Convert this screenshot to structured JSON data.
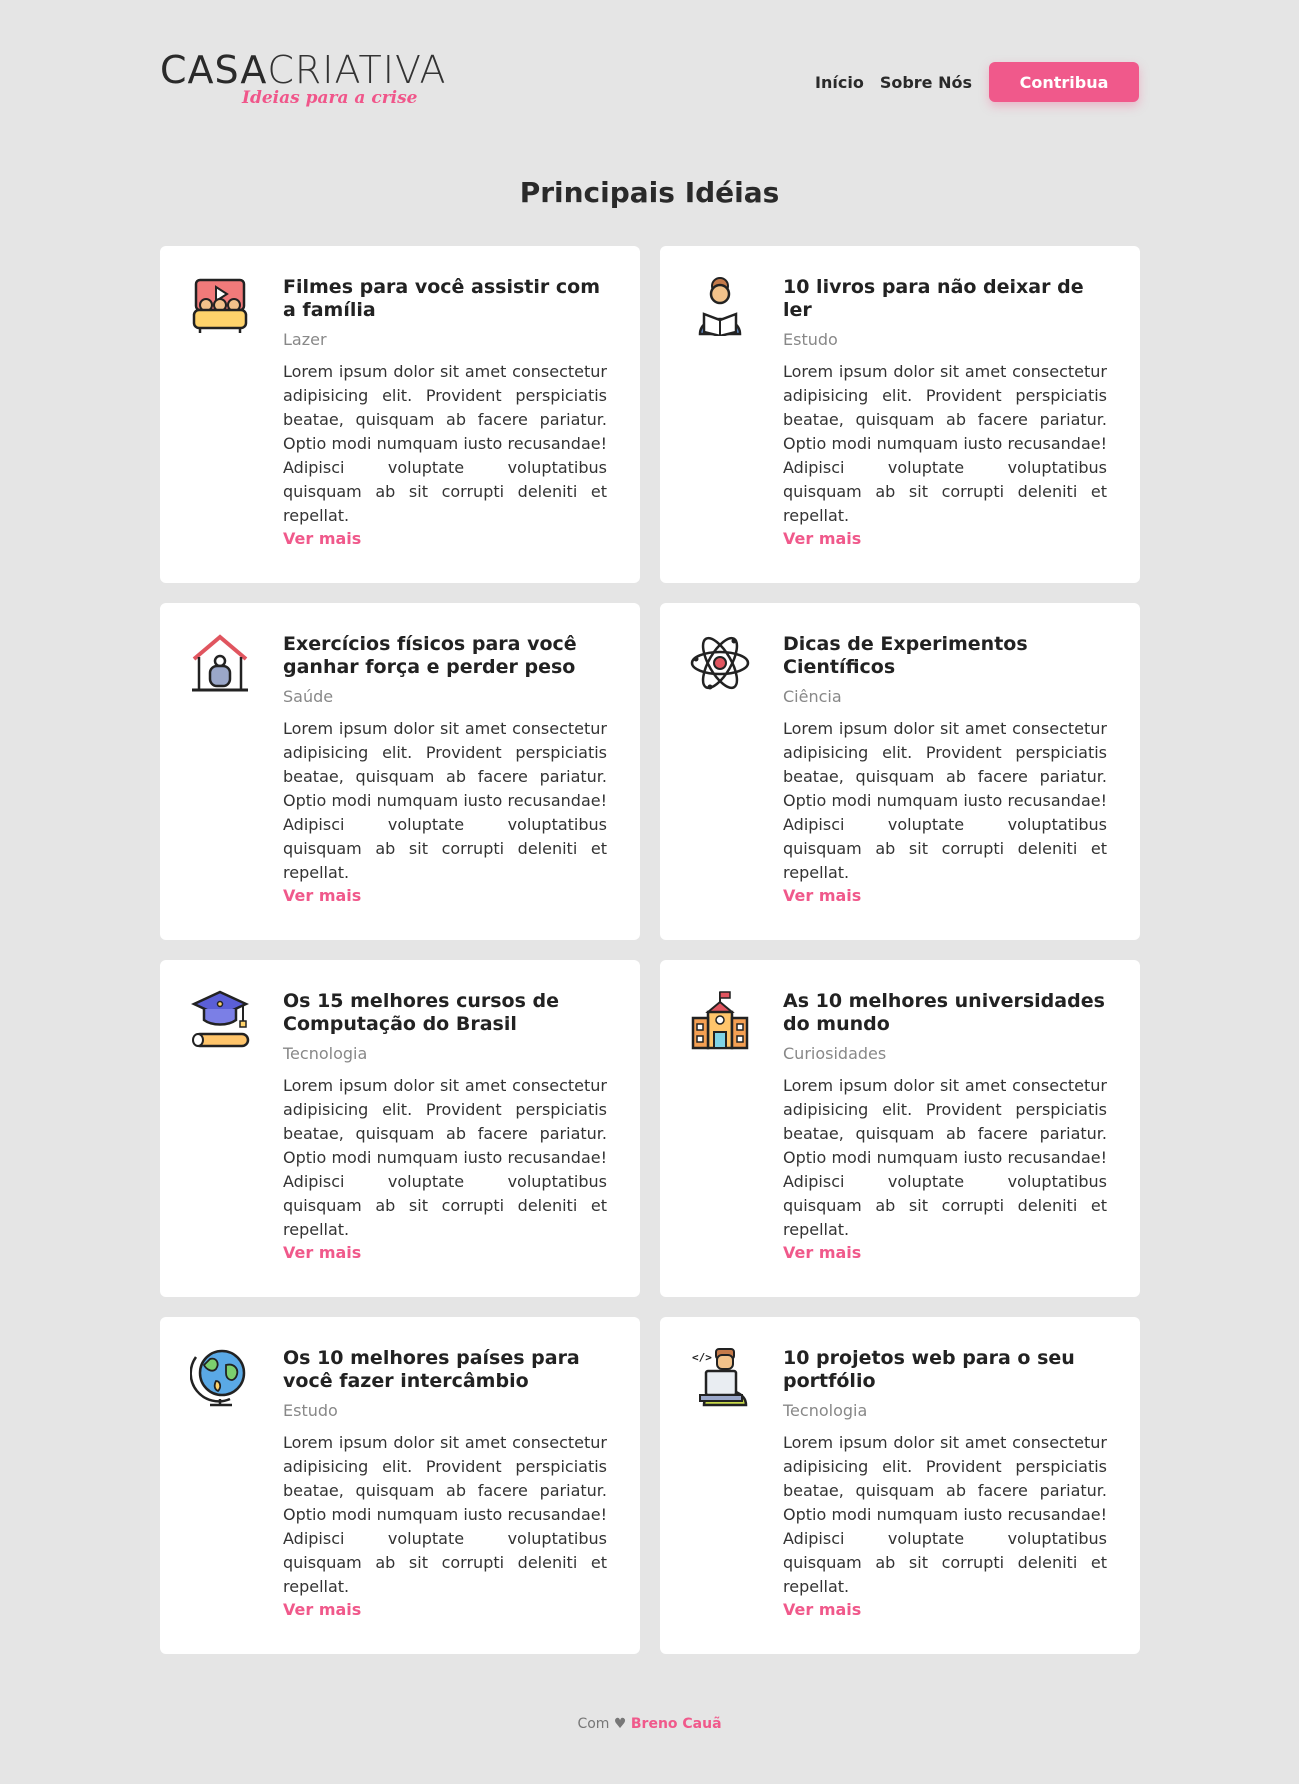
{
  "header": {
    "logo_part1": "CASA",
    "logo_part2": "CRIATIVA",
    "logo_tagline": "Ideias para a crise",
    "nav": {
      "inicio": "Início",
      "sobre": "Sobre Nós",
      "contribua": "Contribua"
    }
  },
  "main": {
    "title": "Principais Idéias",
    "cards": [
      {
        "title": "Filmes para você assistir com a família",
        "category": "Lazer",
        "icon": "movie-couch-icon",
        "text": "Lorem ipsum dolor sit amet consectetur adipisicing elit. Provident perspiciatis beatae, quisquam ab facere pariatur. Optio modi numquam iusto recusandae! Adipisci voluptate voluptatibus quisquam ab sit corrupti deleniti et repellat.",
        "more": "Ver mais"
      },
      {
        "title": "10 livros para não deixar de ler",
        "category": "Estudo",
        "icon": "reader-icon",
        "text": "Lorem ipsum dolor sit amet consectetur adipisicing elit. Provident perspiciatis beatae, quisquam ab facere pariatur. Optio modi numquam iusto recusandae! Adipisci voluptate voluptatibus quisquam ab sit corrupti deleniti et repellat.",
        "more": "Ver mais"
      },
      {
        "title": "Exercícios físicos para você ganhar força e perder peso",
        "category": "Saúde",
        "icon": "home-workout-icon",
        "text": "Lorem ipsum dolor sit amet consectetur adipisicing elit. Provident perspiciatis beatae, quisquam ab facere pariatur. Optio modi numquam iusto recusandae! Adipisci voluptate voluptatibus quisquam ab sit corrupti deleniti et repellat.",
        "more": "Ver mais"
      },
      {
        "title": "Dicas de Experimentos Científicos",
        "category": "Ciência",
        "icon": "atom-icon",
        "text": "Lorem ipsum dolor sit amet consectetur adipisicing elit. Provident perspiciatis beatae, quisquam ab facere pariatur. Optio modi numquam iusto recusandae! Adipisci voluptate voluptatibus quisquam ab sit corrupti deleniti et repellat.",
        "more": "Ver mais"
      },
      {
        "title": "Os 15 melhores cursos de Computação do Brasil",
        "category": "Tecnologia",
        "icon": "graduation-cap-icon",
        "text": "Lorem ipsum dolor sit amet consectetur adipisicing elit. Provident perspiciatis beatae, quisquam ab facere pariatur. Optio modi numquam iusto recusandae! Adipisci voluptate voluptatibus quisquam ab sit corrupti deleniti et repellat.",
        "more": "Ver mais"
      },
      {
        "title": "As 10 melhores universidades do mundo",
        "category": "Curiosidades",
        "icon": "university-icon",
        "text": "Lorem ipsum dolor sit amet consectetur adipisicing elit. Provident perspiciatis beatae, quisquam ab facere pariatur. Optio modi numquam iusto recusandae! Adipisci voluptate voluptatibus quisquam ab sit corrupti deleniti et repellat.",
        "more": "Ver mais"
      },
      {
        "title": "Os 10 melhores países para você fazer intercâmbio",
        "category": "Estudo",
        "icon": "globe-icon",
        "text": "Lorem ipsum dolor sit amet consectetur adipisicing elit. Provident perspiciatis beatae, quisquam ab facere pariatur. Optio modi numquam iusto recusandae! Adipisci voluptate voluptatibus quisquam ab sit corrupti deleniti et repellat.",
        "more": "Ver mais"
      },
      {
        "title": "10 projetos web para o seu portfólio",
        "category": "Tecnologia",
        "icon": "developer-icon",
        "text": "Lorem ipsum dolor sit amet consectetur adipisicing elit. Provident perspiciatis beatae, quisquam ab facere pariatur. Optio modi numquam iusto recusandae! Adipisci voluptate voluptatibus quisquam ab sit corrupti deleniti et repellat.",
        "more": "Ver mais"
      }
    ]
  },
  "footer": {
    "prefix": "Com ♥",
    "author": "Breno Cauã"
  },
  "colors": {
    "accent": "#f0598b",
    "background": "#e5e5e5",
    "card": "#ffffff"
  }
}
